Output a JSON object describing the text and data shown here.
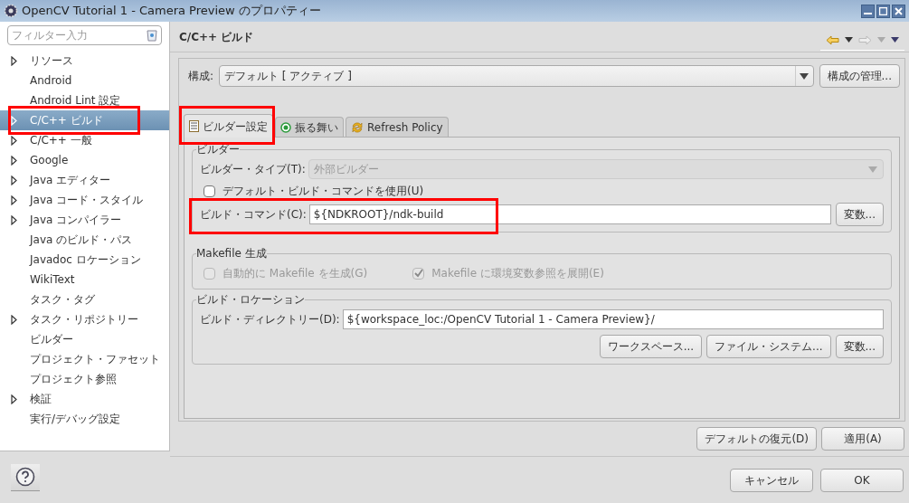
{
  "window": {
    "title": "OpenCV Tutorial 1 - Camera Preview のプロパティー"
  },
  "filter": {
    "placeholder": "フィルター入力"
  },
  "sidebar": {
    "items": [
      {
        "label": "リソース",
        "expandable": true,
        "selected": false,
        "highlighted": false
      },
      {
        "label": "Android",
        "expandable": false,
        "selected": false,
        "highlighted": false
      },
      {
        "label": "Android Lint 設定",
        "expandable": false,
        "selected": false,
        "highlighted": false
      },
      {
        "label": "C/C++ ビルド",
        "expandable": true,
        "selected": true,
        "highlighted": true
      },
      {
        "label": "C/C++ 一般",
        "expandable": true,
        "selected": false,
        "highlighted": false
      },
      {
        "label": "Google",
        "expandable": true,
        "selected": false,
        "highlighted": false
      },
      {
        "label": "Java エディター",
        "expandable": true,
        "selected": false,
        "highlighted": false
      },
      {
        "label": "Java コード・スタイル",
        "expandable": true,
        "selected": false,
        "highlighted": false
      },
      {
        "label": "Java コンパイラー",
        "expandable": true,
        "selected": false,
        "highlighted": false
      },
      {
        "label": "Java のビルド・パス",
        "expandable": false,
        "selected": false,
        "highlighted": false
      },
      {
        "label": "Javadoc ロケーション",
        "expandable": false,
        "selected": false,
        "highlighted": false
      },
      {
        "label": "WikiText",
        "expandable": false,
        "selected": false,
        "highlighted": false
      },
      {
        "label": "タスク・タグ",
        "expandable": false,
        "selected": false,
        "highlighted": false
      },
      {
        "label": "タスク・リポジトリー",
        "expandable": true,
        "selected": false,
        "highlighted": false
      },
      {
        "label": "ビルダー",
        "expandable": false,
        "selected": false,
        "highlighted": false
      },
      {
        "label": "プロジェクト・ファセット",
        "expandable": false,
        "selected": false,
        "highlighted": false
      },
      {
        "label": "プロジェクト参照",
        "expandable": false,
        "selected": false,
        "highlighted": false
      },
      {
        "label": "検証",
        "expandable": true,
        "selected": false,
        "highlighted": false
      },
      {
        "label": "実行/デバッグ設定",
        "expandable": false,
        "selected": false,
        "highlighted": false
      }
    ]
  },
  "page": {
    "title": "C/C++ ビルド",
    "config": {
      "label": "構成:",
      "value": "デフォルト [ アクティブ ]",
      "button": "構成の管理..."
    },
    "tabs": [
      {
        "label": "ビルダー設定",
        "selected": true,
        "highlighted": true
      },
      {
        "label": "振る舞い",
        "selected": false,
        "highlighted": false
      },
      {
        "label": "Refresh Policy",
        "selected": false,
        "highlighted": false
      }
    ],
    "builder": {
      "title": "ビルダー",
      "type_label": "ビルダー・タイプ(T):",
      "type_value": "外部ビルダー",
      "type_disabled": true,
      "default_cmd": {
        "label": "デフォルト・ビルド・コマンドを使用(U)",
        "checked": false,
        "disabled": false
      },
      "cmd_label": "ビルド・コマンド(C):",
      "cmd_value": "${NDKROOT}/ndk-build",
      "cmd_highlighted": true,
      "cmd_button": "変数..."
    },
    "makefile": {
      "title": "Makefile 生成",
      "options": [
        {
          "label": "自動的に Makefile を生成(G)",
          "checked": false,
          "disabled": true
        },
        {
          "label": "Makefile に環境変数参照を展開(E)",
          "checked": true,
          "disabled": true
        }
      ]
    },
    "location": {
      "title": "ビルド・ロケーション",
      "dir_label": "ビルド・ディレクトリー(D):",
      "dir_value": "${workspace_loc:/OpenCV Tutorial 1 - Camera Preview}/",
      "buttons": [
        "ワークスペース...",
        "ファイル・システム...",
        "変数..."
      ]
    },
    "buttons": [
      "デフォルトの復元(D)",
      "適用(A)"
    ]
  },
  "footer": {
    "buttons": [
      "キャンセル",
      "OK"
    ]
  }
}
